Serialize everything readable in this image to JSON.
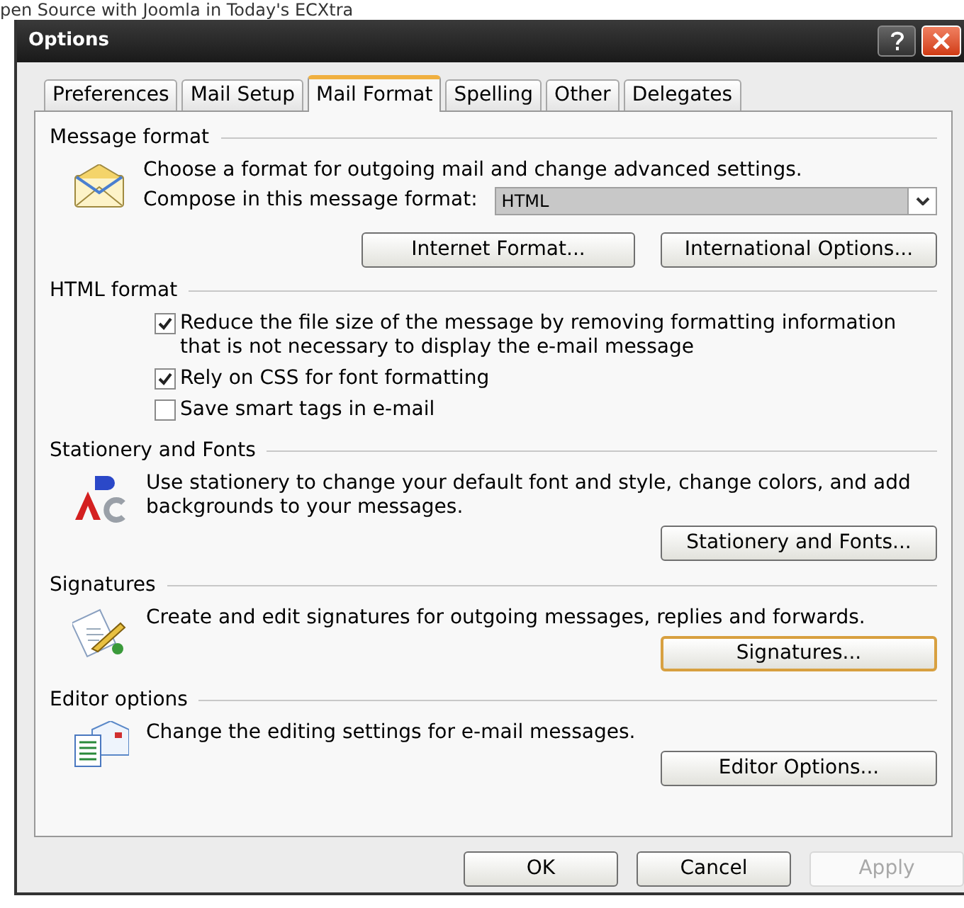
{
  "background_text": "pen Source with Joomla in Today's ECXtra",
  "window": {
    "title": "Options"
  },
  "tabs": [
    {
      "label": "Preferences",
      "selected": false
    },
    {
      "label": "Mail Setup",
      "selected": false
    },
    {
      "label": "Mail Format",
      "selected": true
    },
    {
      "label": "Spelling",
      "selected": false
    },
    {
      "label": "Other",
      "selected": false
    },
    {
      "label": "Delegates",
      "selected": false
    }
  ],
  "sections": [
    {
      "kind": "compose",
      "title": "Message format",
      "description": "Choose a format for outgoing mail and change advanced settings.",
      "compose_label": "Compose in this message format:",
      "format_value": "HTML",
      "buttons": [
        {
          "label": "Internet Format...",
          "focused": false
        },
        {
          "label": "International Options...",
          "focused": false
        }
      ]
    },
    {
      "kind": "checkboxes",
      "title": "HTML format",
      "options": [
        {
          "label": "Reduce the file size of the message by removing formatting information that is not necessary to display the e-mail message",
          "checked": true
        },
        {
          "label": "Rely on CSS for font formatting",
          "checked": true
        },
        {
          "label": "Save smart tags in e-mail",
          "checked": false
        }
      ]
    },
    {
      "kind": "action",
      "title": "Stationery and Fonts",
      "description": "Use stationery to change your default font and style, change colors, and add backgrounds to your messages.",
      "buttons": [
        {
          "label": "Stationery and Fonts...",
          "focused": false
        }
      ]
    },
    {
      "kind": "action",
      "title": "Signatures",
      "description": "Create and edit signatures for outgoing messages, replies and forwards.",
      "buttons": [
        {
          "label": "Signatures...",
          "focused": true
        }
      ]
    },
    {
      "kind": "action",
      "title": "Editor options",
      "description": "Change the editing settings for e-mail messages.",
      "buttons": [
        {
          "label": "Editor Options...",
          "focused": false
        }
      ]
    }
  ],
  "footer_buttons": [
    {
      "label": "OK",
      "disabled": false
    },
    {
      "label": "Cancel",
      "disabled": false
    },
    {
      "label": "Apply",
      "disabled": true
    }
  ]
}
